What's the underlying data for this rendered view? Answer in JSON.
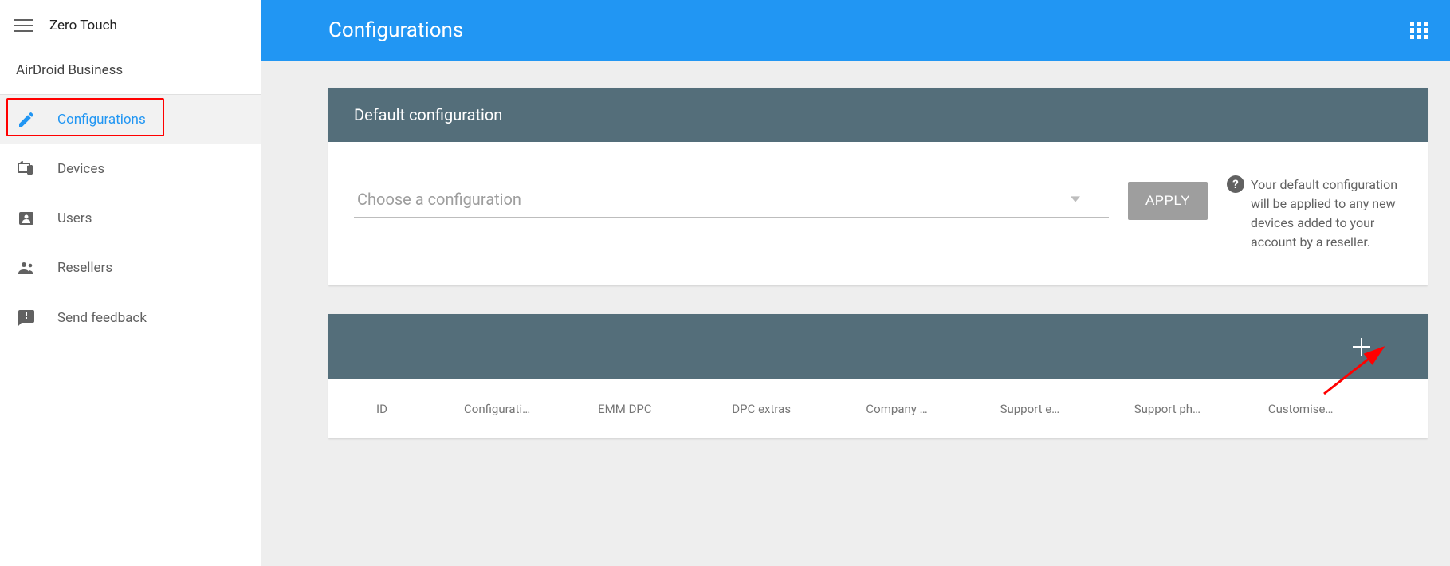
{
  "product": "Zero Touch",
  "org": "AirDroid Business",
  "header_title": "Configurations",
  "sidebar": {
    "items": [
      {
        "label": "Configurations",
        "icon": "pencil"
      },
      {
        "label": "Devices",
        "icon": "devices"
      },
      {
        "label": "Users",
        "icon": "user"
      },
      {
        "label": "Resellers",
        "icon": "people"
      }
    ],
    "footer": [
      {
        "label": "Send feedback",
        "icon": "feedback"
      }
    ]
  },
  "default_card": {
    "title": "Default configuration",
    "dropdown_placeholder": "Choose a configuration",
    "apply_label": "APPLY",
    "help_text": "Your default configuration will be applied to any new devices added to your account by a reseller."
  },
  "config_table": {
    "columns": [
      "ID",
      "Configurati…",
      "EMM DPC",
      "DPC extras",
      "Company …",
      "Support e…",
      "Support ph…",
      "Customise…"
    ]
  },
  "colors": {
    "primary": "#2196f3",
    "card_header": "#546e7a",
    "highlight": "#ff0000"
  }
}
